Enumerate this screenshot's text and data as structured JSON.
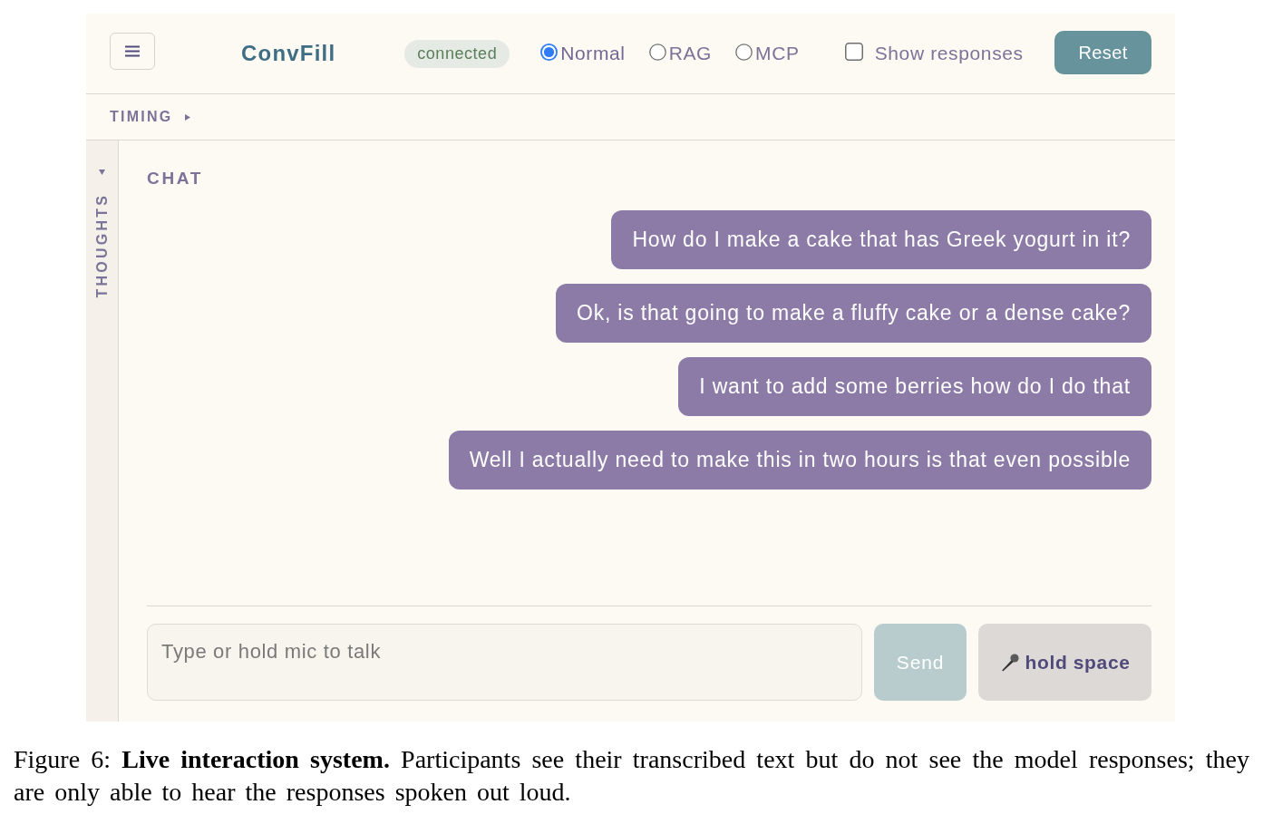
{
  "header": {
    "title": "ConvFill",
    "status": "connected",
    "modes": [
      {
        "label": "Normal",
        "selected": true
      },
      {
        "label": "RAG",
        "selected": false
      },
      {
        "label": "MCP",
        "selected": false
      }
    ],
    "show_responses": {
      "label": "Show responses",
      "checked": false
    },
    "reset_button": "Reset"
  },
  "timing_panel": {
    "label": "TIMING"
  },
  "thoughts_panel": {
    "label": "THOUGHTS"
  },
  "chat": {
    "heading": "CHAT",
    "messages": [
      {
        "text": "How do I make a cake that has Greek yogurt in it?"
      },
      {
        "text": "Ok, is that going to make a fluffy cake or a dense cake?"
      },
      {
        "text": "I want to add some berries how do I do that"
      },
      {
        "text": "Well I actually need to make this in two hours is that even possible"
      }
    ],
    "input": {
      "placeholder": "Type or hold mic to talk"
    },
    "send_button": {
      "label": "Send",
      "disabled": true
    },
    "mic_button": {
      "label": "hold space"
    }
  },
  "caption": "Figure 6: **Live interaction system.** Participants see their transcribed text but do not see the model responses; they are only able to hear the responses spoken out loud."
}
